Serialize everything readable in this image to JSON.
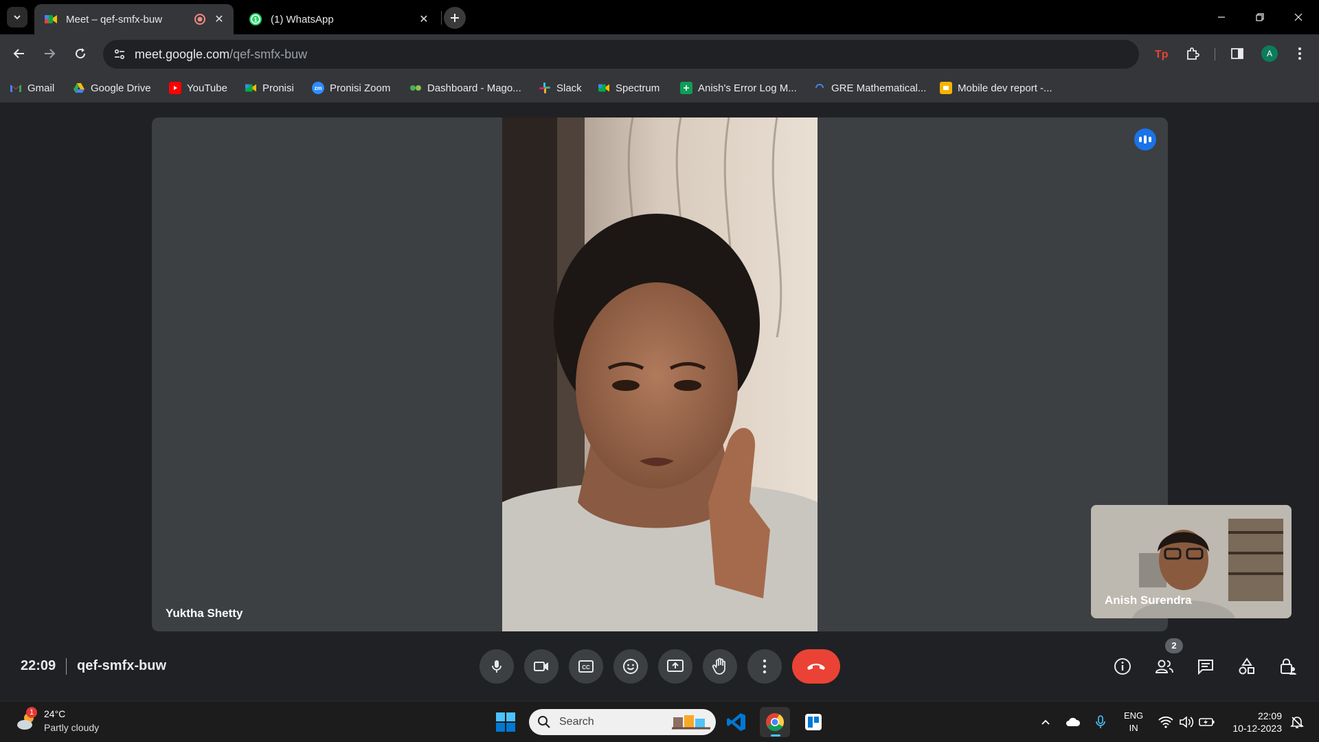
{
  "browser": {
    "tabs": [
      {
        "title": "Meet – qef-smfx-buw",
        "active": true,
        "icon": "meet-icon",
        "recording": true
      },
      {
        "title": "(1) WhatsApp",
        "active": false,
        "icon": "whatsapp-icon"
      }
    ],
    "url_domain": "meet.google.com",
    "url_path": "/qef-smfx-buw",
    "profile_initial": "A",
    "bookmarks": [
      {
        "label": "Gmail",
        "icon": "gmail-icon",
        "color": "#ea4335"
      },
      {
        "label": "Google Drive",
        "icon": "drive-icon",
        "color": "#34a853"
      },
      {
        "label": "YouTube",
        "icon": "youtube-icon",
        "color": "#ff0000"
      },
      {
        "label": "Pronisi",
        "icon": "meet-icon",
        "color": "#00832d"
      },
      {
        "label": "Pronisi Zoom",
        "icon": "zoom-icon",
        "color": "#2d8cff"
      },
      {
        "label": "Dashboard - Mago...",
        "icon": "dashboard-icon",
        "color": "#4caf50"
      },
      {
        "label": "Slack",
        "icon": "slack-icon",
        "color": "#e01e5a"
      },
      {
        "label": "Spectrum",
        "icon": "meet-icon",
        "color": "#00832d"
      },
      {
        "label": "Anish's Error Log M...",
        "icon": "sheets-icon",
        "color": "#0f9d58"
      },
      {
        "label": "GRE Mathematical...",
        "icon": "loader-icon",
        "color": "#4285f4"
      },
      {
        "label": "Mobile dev report -...",
        "icon": "slides-icon",
        "color": "#f4b400"
      }
    ]
  },
  "meeting": {
    "main_participant": "Yuktha Shetty",
    "self_participant": "Anish Surendra",
    "time": "22:09",
    "code": "qef-smfx-buw",
    "participant_count": "2"
  },
  "taskbar": {
    "temperature": "24°C",
    "weather": "Partly cloudy",
    "weather_badge": "1",
    "search_label": "Search",
    "lang_line1": "ENG",
    "lang_line2": "IN",
    "time": "22:09",
    "date": "10-12-2023"
  }
}
